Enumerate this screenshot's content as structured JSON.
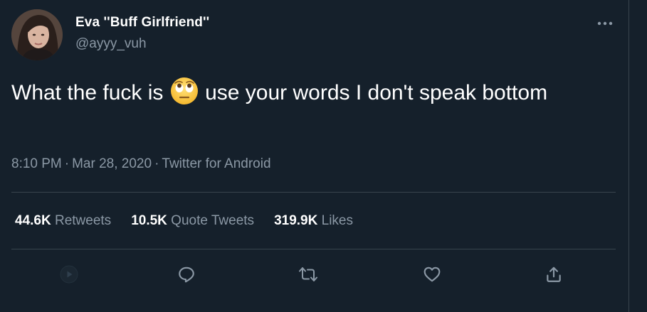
{
  "tweet": {
    "author": {
      "display_name": "Eva ''Buff Girlfriend''",
      "handle": "@ayyy_vuh"
    },
    "text_before_emoji": "What the fuck is ",
    "emoji": "face-with-rolling-eyes",
    "text_after_emoji": " use your words I don't speak bottom",
    "time": "8:10 PM",
    "date": "Mar 28, 2020",
    "separator": "·",
    "source": "Twitter for Android"
  },
  "stats": {
    "retweets_count": "44.6K",
    "retweets_label": "Retweets",
    "quotes_count": "10.5K",
    "quotes_label": "Quote Tweets",
    "likes_count": "319.9K",
    "likes_label": "Likes"
  },
  "actions": [
    "play-icon",
    "reply-icon",
    "retweet-icon",
    "like-icon",
    "share-icon"
  ],
  "colors": {
    "background": "#15202b",
    "text": "#ffffff",
    "secondary_text": "#8b98a5",
    "border": "#38444d",
    "icon": "#8b98a5"
  }
}
